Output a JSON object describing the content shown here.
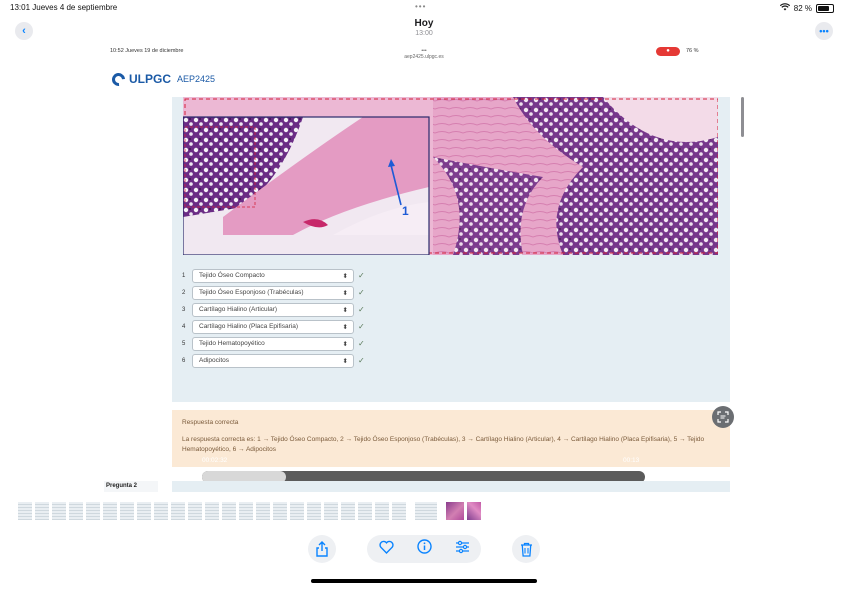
{
  "status_bar": {
    "time_date": "13:01  Jueves 4 de septiembre",
    "dots": "•••",
    "battery": "82 %"
  },
  "header": {
    "title": "Hoy",
    "subtitle": "13:00"
  },
  "inner": {
    "status_time_date": "10:52  Jueves 19 de diciembre",
    "dots": "•••",
    "url": "aep2425.ulpgc.es",
    "battery": "76 %",
    "logo_text": "ULPGC",
    "course": "AEP2425",
    "image_label": "1",
    "dropdowns": [
      {
        "num": "1",
        "value": "Tejido Óseo Compacto"
      },
      {
        "num": "2",
        "value": "Tejido Óseo Esponjoso (Trabéculas)"
      },
      {
        "num": "3",
        "value": "Cartílago Hialino (Articular)"
      },
      {
        "num": "4",
        "value": "Cartílago Hialino (Placa Epifisaria)"
      },
      {
        "num": "5",
        "value": "Tejido Hematopoyético"
      },
      {
        "num": "6",
        "value": "Adipocitos"
      }
    ],
    "check_mark": "✓",
    "answer": {
      "title": "Respuesta correcta",
      "text": "La respuesta correcta es: 1 → Tejido Óseo Compacto, 2 → Tejido Óseo Esponjoso (Trabéculas), 3 → Cartílago Hialino (Articular), 4 → Cartílago Hialino (Placa Epifisaria), 5 → Tejido Hematopoyético, 6 → Adipocitos"
    },
    "video": {
      "elapsed": "00:02:32",
      "remaining": "00:13"
    },
    "next_question": "Pregunta 2"
  },
  "icons": {
    "back": "chevron-left-icon",
    "more": "ellipsis-icon",
    "share": "share-icon",
    "favorite": "heart-icon",
    "info": "info-icon",
    "adjust": "sliders-icon",
    "delete": "trash-icon"
  },
  "colors": {
    "accent": "#0a84ff",
    "brand": "#1b5aa6",
    "answer_bg": "#fbe9d5",
    "panel_bg": "#e5eef3"
  }
}
